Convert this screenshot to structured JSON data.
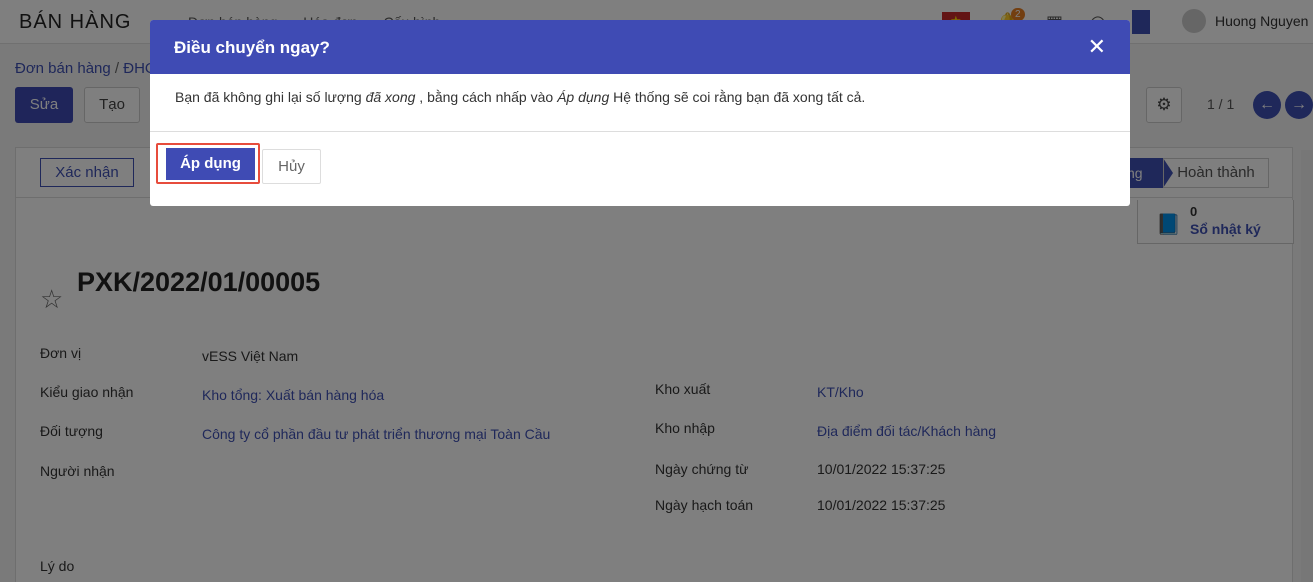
{
  "app": {
    "title": "BÁN HÀNG",
    "menu": [
      "Đơn bán hàng",
      "Hóa đơn",
      "Cấu hình"
    ],
    "notification_count": "2",
    "user": "Huong Nguyen"
  },
  "breadcrumb": {
    "first": "Đơn bán hàng",
    "second": "ĐHO"
  },
  "toolbar": {
    "edit": "Sửa",
    "create": "Tạo",
    "pager": "1 / 1"
  },
  "status": {
    "confirm": "Xác nhận",
    "current_stage": "ng",
    "done_stage": "Hoàn thành"
  },
  "log": {
    "count": "0",
    "label": "Sổ nhật ký"
  },
  "record": {
    "name": "PXK/2022/01/00005",
    "don_vi_label": "Đơn vị",
    "don_vi": "vESS Việt Nam",
    "kieu_label": "Kiểu giao nhận",
    "kieu": "Kho tổng: Xuất bán hàng hóa",
    "doi_tuong_label": "Đối tượng",
    "doi_tuong": "Công ty cổ phần đầu tư phát triển thương mại Toàn Cầu",
    "nguoi_nhan_label": "Người nhận",
    "ly_do_label": "Lý do",
    "kho_xuat_label": "Kho xuất",
    "kho_xuat": "KT/Kho",
    "kho_nhap_label": "Kho nhập",
    "kho_nhap": "Địa điểm đối tác/Khách hàng",
    "ngay_ct_label": "Ngày chứng từ",
    "ngay_ct": "10/01/2022 15:37:25",
    "ngay_ht_label": "Ngày hạch toán",
    "ngay_ht": "10/01/2022 15:37:25"
  },
  "dialog": {
    "title": "Điều chuyển ngay?",
    "text_1": "Bạn đã không ghi lại số lượng ",
    "text_em1": "đã xong",
    "text_2": " , bằng cách nhấp vào ",
    "text_em2": "Áp dụng",
    "text_3": " Hệ thống sẽ coi rằng bạn đã xong tất cả.",
    "apply": "Áp dụng",
    "cancel": "Hủy"
  }
}
